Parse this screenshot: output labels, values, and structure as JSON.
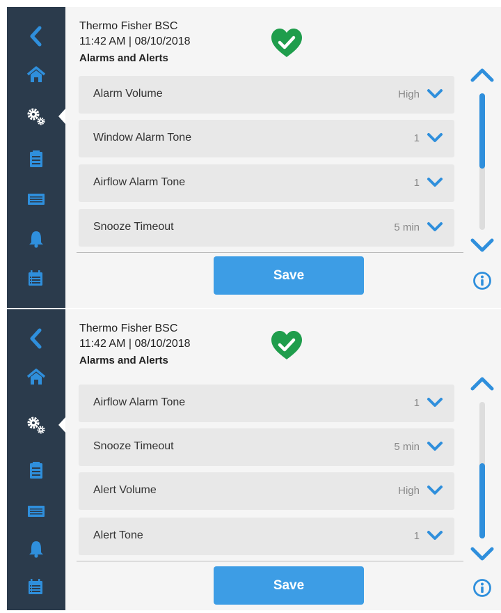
{
  "colors": {
    "sidebar_bg": "#2b3b4c",
    "accent_blue": "#2f8fdc",
    "status_green": "#1f9d4c",
    "list_item_bg": "#e8e8e8",
    "panel_bg": "#f5f5f5"
  },
  "sidebar_icons": [
    "back-arrow-icon",
    "home-icon",
    "gears-icon",
    "clipboard-icon",
    "filter-icon",
    "bell-icon",
    "calendar-list-icon"
  ],
  "screens": [
    {
      "header": {
        "device_name": "Thermo Fisher BSC",
        "time_date": "11:42  AM | 08/10/2018",
        "page_title": "Alarms and Alerts"
      },
      "status_icon": "heart-check-icon",
      "items": [
        {
          "label": "Alarm Volume",
          "value": "High"
        },
        {
          "label": "Window Alarm Tone",
          "value": "1"
        },
        {
          "label": "Airflow Alarm Tone",
          "value": "1"
        },
        {
          "label": "Snooze Timeout",
          "value": "5 min"
        }
      ],
      "save_label": "Save",
      "scroll_position": 0.0,
      "scroll_fraction": 0.55
    },
    {
      "header": {
        "device_name": "Thermo Fisher BSC",
        "time_date": "11:42  AM | 08/10/2018",
        "page_title": "Alarms and Alerts"
      },
      "status_icon": "heart-check-icon",
      "items": [
        {
          "label": "Airflow Alarm Tone",
          "value": "1"
        },
        {
          "label": "Snooze Timeout",
          "value": "5 min"
        },
        {
          "label": "Alert Volume",
          "value": "High"
        },
        {
          "label": "Alert Tone",
          "value": "1"
        }
      ],
      "save_label": "Save",
      "scroll_position": 1.0,
      "scroll_fraction": 0.55
    }
  ]
}
